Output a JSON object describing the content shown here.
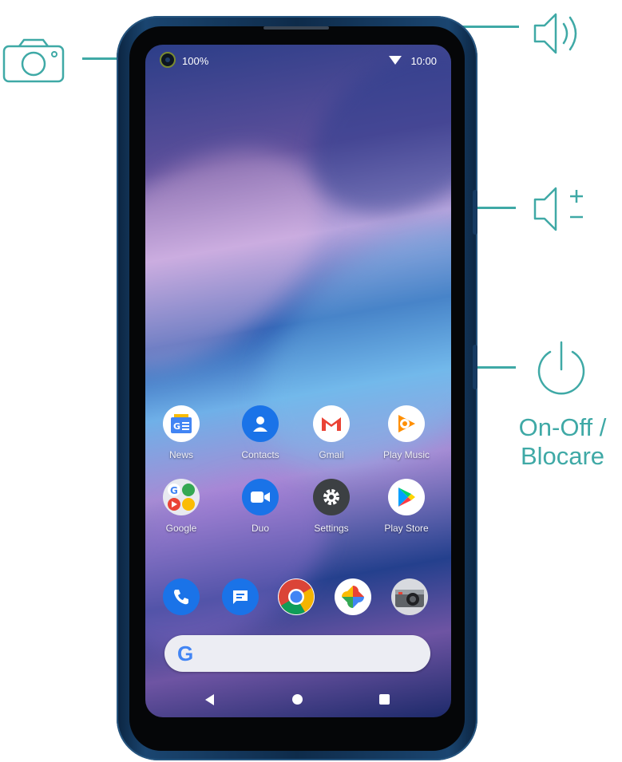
{
  "annotations": {
    "camera": {
      "icon": "camera-icon"
    },
    "speaker": {
      "icon": "speaker-icon"
    },
    "volume": {
      "icon": "volume-rocker-icon"
    },
    "power": {
      "icon": "power-icon",
      "label_line1": "On-Off /",
      "label_line2": "Blocare"
    }
  },
  "status_bar": {
    "battery": "100%",
    "time": "10:00",
    "wifi_icon": "wifi-icon"
  },
  "apps_row1": [
    {
      "label": "News",
      "icon": "news-icon"
    },
    {
      "label": "Contacts",
      "icon": "contacts-icon"
    },
    {
      "label": "Gmail",
      "icon": "gmail-icon"
    },
    {
      "label": "Play Music",
      "icon": "play-music-icon"
    }
  ],
  "apps_row2": [
    {
      "label": "Google",
      "icon": "google-folder-icon"
    },
    {
      "label": "Duo",
      "icon": "duo-icon"
    },
    {
      "label": "Settings",
      "icon": "settings-icon"
    },
    {
      "label": "Play Store",
      "icon": "play-store-icon"
    }
  ],
  "dock": [
    "phone-icon",
    "messages-icon",
    "chrome-icon",
    "photos-icon",
    "camera-app-icon"
  ],
  "search_bar": {
    "logo": "G"
  },
  "navigation": [
    "back-button",
    "home-button",
    "recents-button"
  ],
  "colors": {
    "accent": "#3fa9a6",
    "phone_body": "#163a62"
  }
}
